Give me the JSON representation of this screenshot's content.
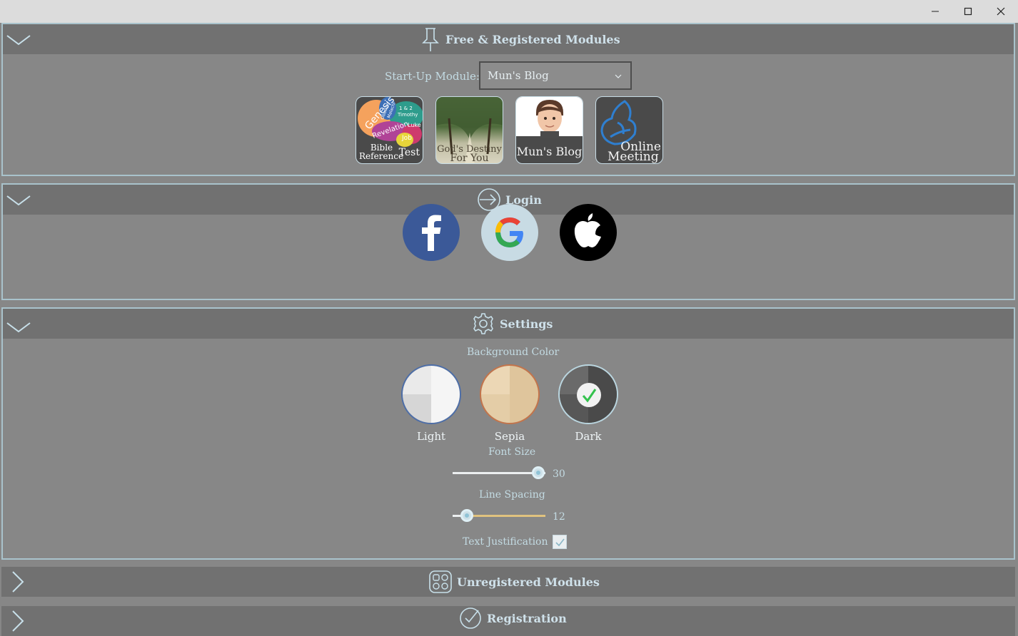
{
  "window": {
    "minimize_icon": "minimize-icon",
    "maximize_icon": "maximize-icon",
    "close_icon": "close-icon"
  },
  "sections": {
    "modules": {
      "title": "Free & Registered Modules",
      "startup_label": "Start-Up Module:",
      "startup_value": "Mun's Blog",
      "tiles": [
        {
          "name": "bible-reference-test",
          "line1": "Bible",
          "line2": "Reference",
          "line3": "Test",
          "tags": [
            "Genesis",
            "Revelation",
            "Luke",
            "Job",
            "1 & 2",
            "Timothy",
            "Malachi",
            "Obadiah"
          ]
        },
        {
          "name": "gods-destiny-for-you",
          "line1": "God's Destiny",
          "line2": "For You"
        },
        {
          "name": "muns-blog",
          "line1": "Mun's Blog"
        },
        {
          "name": "online-meeting",
          "line1": "Online",
          "line2": "Meeting"
        }
      ]
    },
    "login": {
      "title": "Login",
      "providers": [
        "facebook",
        "google",
        "apple"
      ]
    },
    "settings": {
      "title": "Settings",
      "background_label": "Background Color",
      "swatches": [
        {
          "label": "Light",
          "selected": false
        },
        {
          "label": "Sepia",
          "selected": false
        },
        {
          "label": "Dark",
          "selected": true
        }
      ],
      "font_size_label": "Font Size",
      "font_size_value": "30",
      "font_size_fraction": 0.92,
      "line_spacing_label": "Line Spacing",
      "line_spacing_value": "12",
      "line_spacing_fraction": 0.15,
      "justification_label": "Text Justification",
      "justification_checked": true
    },
    "unregistered": {
      "title": "Unregistered Modules"
    },
    "registration": {
      "title": "Registration"
    }
  },
  "colors": {
    "accent": "#c3dbe3",
    "header_bg": "#717171",
    "body_bg": "#878787",
    "border": "#a9c3cc",
    "slider_gold": "#e0c27e"
  }
}
